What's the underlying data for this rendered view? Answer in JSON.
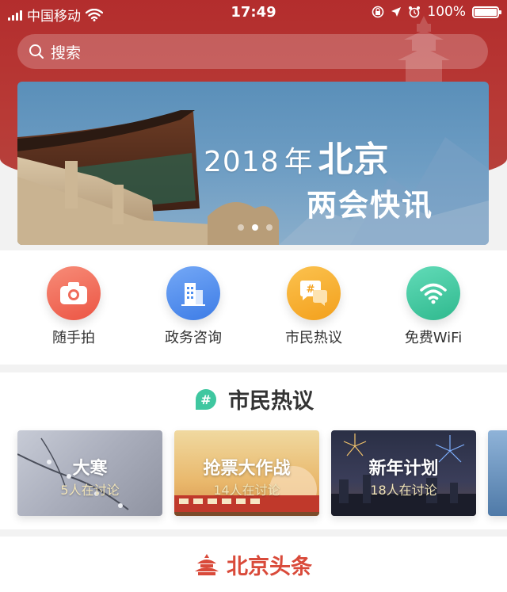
{
  "status_bar": {
    "carrier": "中国移动",
    "time": "17:49",
    "battery": "100%"
  },
  "search": {
    "placeholder": "搜索"
  },
  "banner": {
    "year": "2018",
    "year_suffix": "年",
    "city": "北京",
    "subtitle": "两会快讯",
    "page_count": 3,
    "active_page": 2
  },
  "shortcuts": [
    {
      "label": "随手拍",
      "icon": "camera-icon",
      "color": "#f06a5a"
    },
    {
      "label": "政务咨询",
      "icon": "building-icon",
      "color": "#4e8ff0"
    },
    {
      "label": "市民热议",
      "icon": "hashtag-chat-icon",
      "color": "#f7a928"
    },
    {
      "label": "免费WiFi",
      "icon": "wifi-icon",
      "color": "#3fc7a0"
    }
  ],
  "hot_topics": {
    "title": "市民热议",
    "cards": [
      {
        "title": "大寒",
        "subtitle": "5人在讨论"
      },
      {
        "title": "抢票大作战",
        "subtitle": "14人在讨论"
      },
      {
        "title": "新年计划",
        "subtitle": "18人在讨论"
      }
    ]
  },
  "news": {
    "title": "北京头条"
  },
  "colors": {
    "brand_red": "#b32d2d",
    "accent_red": "#d94a3a"
  }
}
